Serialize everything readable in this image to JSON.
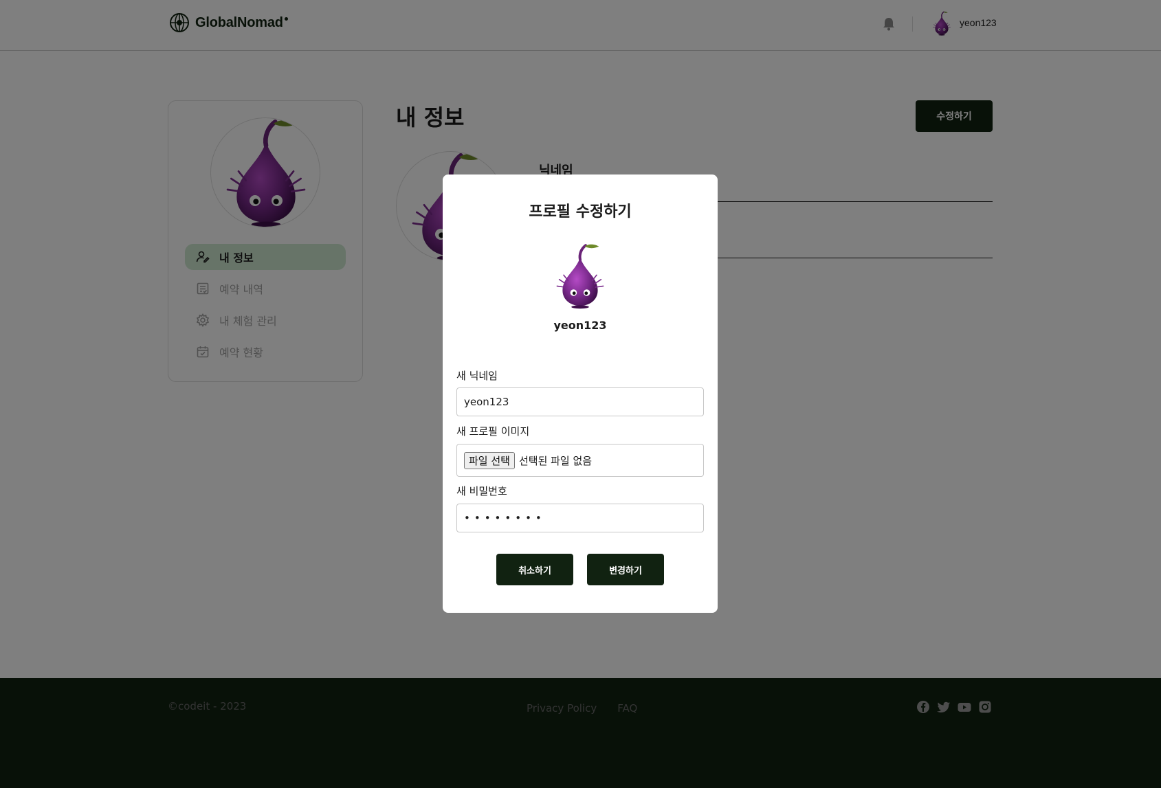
{
  "header": {
    "logo_text": "GlobalNomad",
    "username": "yeon123"
  },
  "sidebar": {
    "items": [
      {
        "label": "내 정보",
        "icon": "user-edit-icon",
        "active": true
      },
      {
        "label": "예약 내역",
        "icon": "list-check-icon",
        "active": false
      },
      {
        "label": "내 체험 관리",
        "icon": "gear-icon",
        "active": false
      },
      {
        "label": "예약 현황",
        "icon": "calendar-check-icon",
        "active": false
      }
    ]
  },
  "main": {
    "title": "내 정보",
    "edit_label": "수정하기",
    "nickname_label": "닉네임"
  },
  "modal": {
    "title": "프로필 수정하기",
    "username": "yeon123",
    "nickname_label": "새 닉네임",
    "nickname_value": "yeon123",
    "image_label": "새 프로필 이미지",
    "file_button": "파일 선택",
    "file_status": "선택된 파일 없음",
    "password_label": "새 비밀번호",
    "password_value": "••••••••",
    "cancel_label": "취소하기",
    "submit_label": "변경하기"
  },
  "footer": {
    "copyright": "©codeit - 2023",
    "links": [
      "Privacy Policy",
      "FAQ"
    ],
    "socials": [
      "facebook-icon",
      "twitter-icon",
      "youtube-icon",
      "instagram-icon"
    ]
  },
  "colors": {
    "brand_dark": "#112211",
    "active_nav": "#cfe8d1",
    "avatar_purple": "#7a2a8c"
  }
}
